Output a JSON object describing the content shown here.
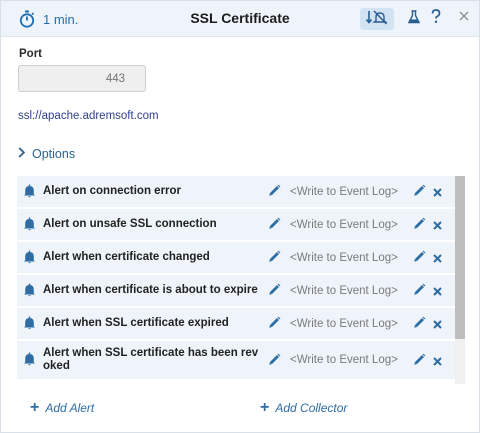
{
  "header": {
    "interval_label": "1 min.",
    "title": "SSL Certificate",
    "icons": [
      "stopwatch-icon",
      "mute-notifications-icon",
      "flask-icon",
      "help-icon",
      "close-icon"
    ],
    "accent_color": "#1e6fb0",
    "background_color": "#eef4fa"
  },
  "port": {
    "label": "Port",
    "placeholder": "443"
  },
  "url": "ssl://apache.adremsoft.com",
  "options": {
    "label": "Options"
  },
  "alerts": [
    {
      "name": "Alert on connection error",
      "action": "<Write to Event Log>"
    },
    {
      "name": "Alert on unsafe SSL connection",
      "action": "<Write to Event Log>"
    },
    {
      "name": "Alert when certificate changed",
      "action": "<Write to Event Log>"
    },
    {
      "name": "Alert when certificate is about to expire",
      "action": "<Write to Event Log>"
    },
    {
      "name": "Alert when SSL certificate expired",
      "action": "<Write to Event Log>"
    },
    {
      "name": "Alert when SSL certificate has been revoked",
      "action": "<Write to Event Log>"
    }
  ],
  "footer": {
    "add_alert": "Add Alert",
    "add_collector": "Add Collector"
  }
}
